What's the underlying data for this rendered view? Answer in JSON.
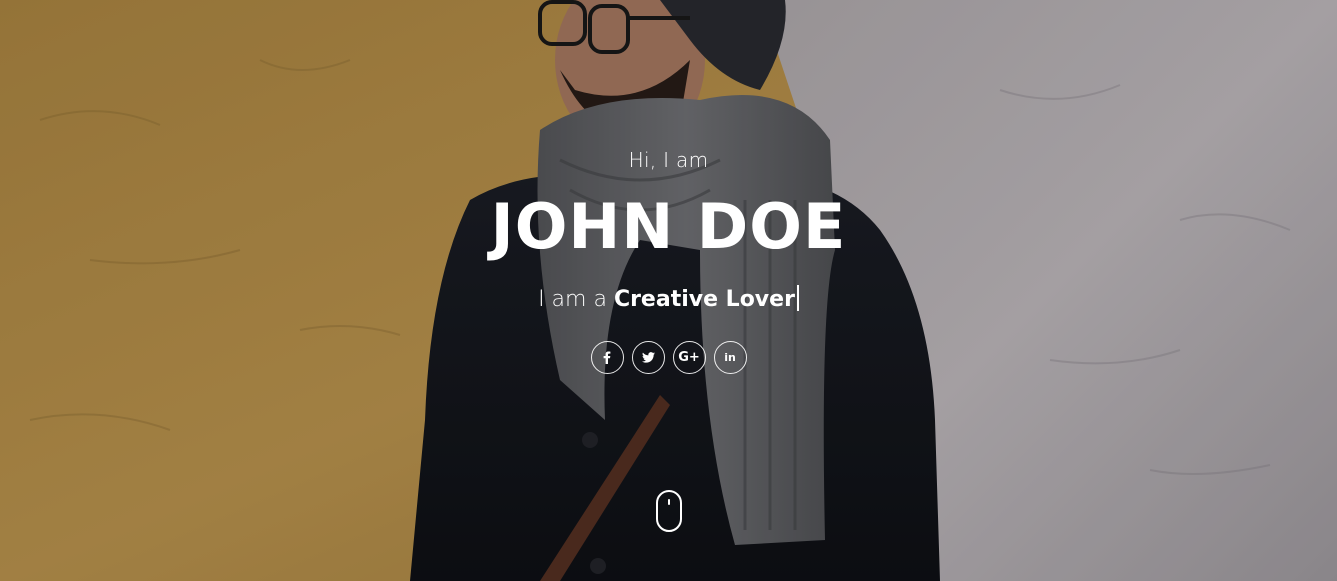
{
  "hero": {
    "greeting": "Hi, I am",
    "name": "JOHN DOE",
    "tagline_prefix": "I am a ",
    "tagline_typed": "Creative Lover"
  },
  "social": [
    {
      "name": "facebook",
      "icon": "facebook-icon",
      "label": "f"
    },
    {
      "name": "twitter",
      "icon": "twitter-icon",
      "label": ""
    },
    {
      "name": "google-plus",
      "icon": "google-plus-icon",
      "label": "G+"
    },
    {
      "name": "linkedin",
      "icon": "linkedin-icon",
      "label": "in"
    }
  ],
  "scroll_indicator": {
    "icon": "mouse-icon"
  },
  "colors": {
    "text": "#ffffff",
    "wall_yellow": "#c79a4a",
    "wall_white": "#c9c4c8",
    "coat": "#15171d",
    "scarf": "#66676a"
  }
}
